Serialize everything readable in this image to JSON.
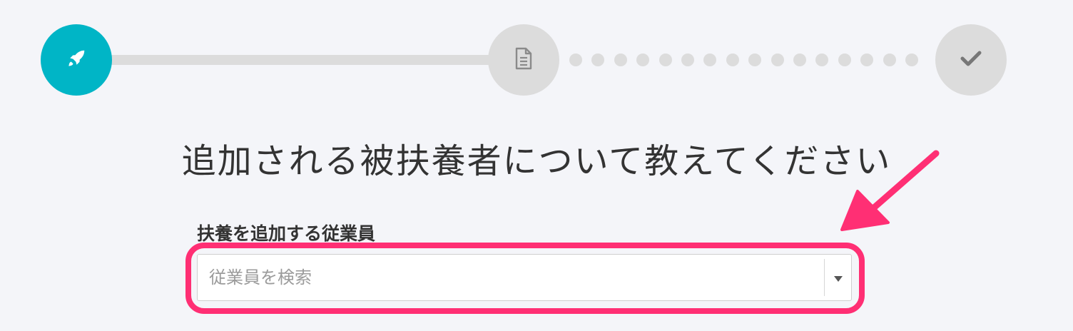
{
  "stepper": {
    "steps": [
      {
        "icon": "rocket-icon",
        "state": "active",
        "color": "#00b5c6"
      },
      {
        "icon": "document-icon",
        "state": "inactive",
        "color": "#dcdcdc"
      },
      {
        "icon": "checkmark-icon",
        "state": "inactive",
        "color": "#dcdcdc"
      }
    ]
  },
  "heading": "追加される被扶養者について教えてください",
  "form": {
    "employee_label": "扶養を追加する従業員",
    "employee_placeholder": "従業員を検索"
  },
  "colors": {
    "accent": "#00b5c6",
    "annotation": "#ff2f74",
    "background": "#f4f5f9"
  }
}
